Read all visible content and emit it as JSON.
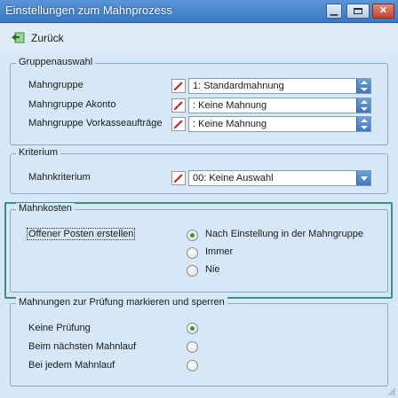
{
  "window": {
    "title": "Einstellungen zum Mahnprozess",
    "buttons": [
      "minimize",
      "restore",
      "close"
    ]
  },
  "toolbar": {
    "back_label": "Zurück",
    "back_icon": "green-back-arrow-icon"
  },
  "gruppenauswahl": {
    "legend": "Gruppenauswahl",
    "rows": [
      {
        "label": "Mahngruppe",
        "value": "1: Standardmahnung"
      },
      {
        "label": "Mahngruppe Akonto",
        "value": ": Keine Mahnung"
      },
      {
        "label": "Mahngruppe Vorkasseaufträge",
        "value": ": Keine Mahnung"
      }
    ]
  },
  "kriterium": {
    "legend": "Kriterium",
    "label": "Mahnkriterium",
    "value": "00: Keine Auswahl"
  },
  "mahnkosten": {
    "legend": "Mahnkosten",
    "checkbox_label": "Offener Posten erstellen",
    "options": [
      {
        "label": "Nach Einstellung in der Mahngruppe",
        "selected": true
      },
      {
        "label": "Immer",
        "selected": false
      },
      {
        "label": "Nie",
        "selected": false
      }
    ]
  },
  "pruefung": {
    "legend": "Mahnungen zur Prüfung markieren und sperren",
    "options": [
      {
        "label": "Keine Prüfung",
        "selected": true
      },
      {
        "label": "Beim nächsten Mahnlauf",
        "selected": false
      },
      {
        "label": "Bei jedem Mahnlauf",
        "selected": false
      }
    ]
  },
  "colors": {
    "titlebar": "#3b78c4",
    "background": "#d6e7f8",
    "highlight_border": "#3f8f78",
    "radio_selected": "#2e9a3a"
  }
}
